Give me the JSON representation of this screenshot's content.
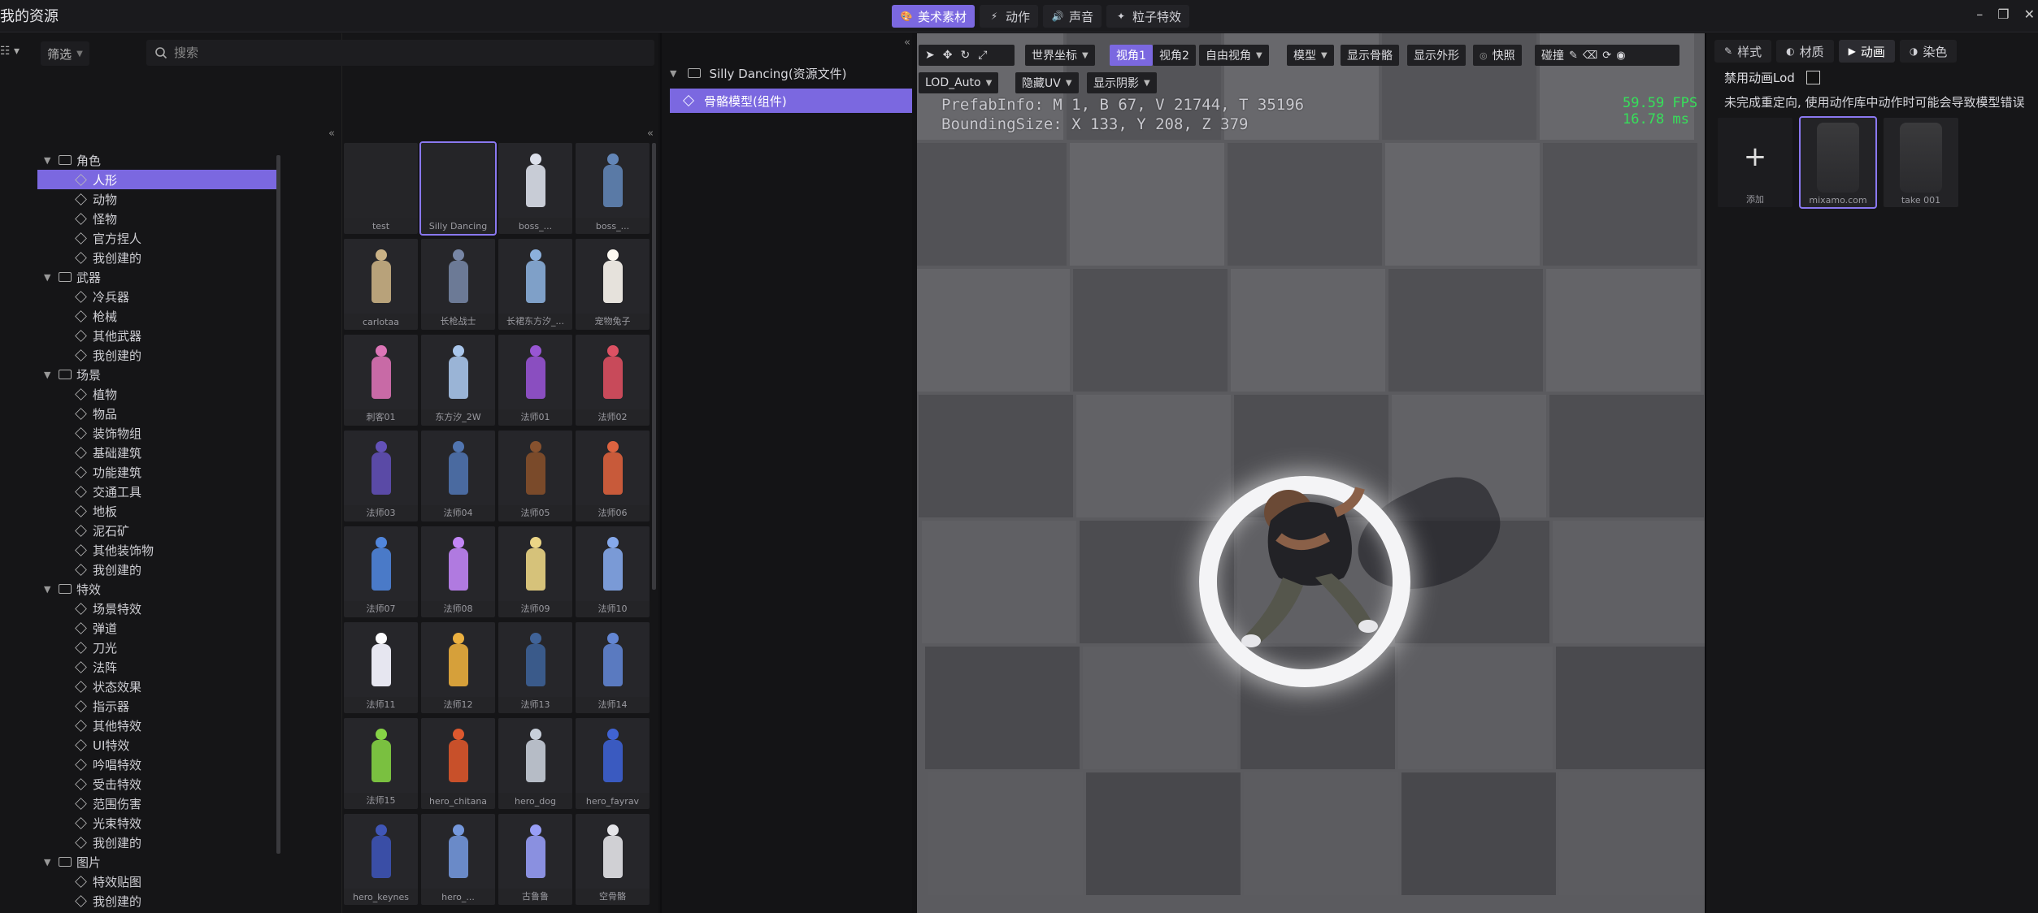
{
  "window": {
    "title": "我的资源",
    "controls": [
      "–",
      "❐",
      "✕"
    ]
  },
  "mode_tabs": [
    {
      "label": "美术素材",
      "icon": "palette-icon",
      "active": true
    },
    {
      "label": "动作",
      "icon": "motion-icon",
      "active": false
    },
    {
      "label": "声音",
      "icon": "sound-icon",
      "active": false
    },
    {
      "label": "粒子特效",
      "icon": "particle-icon",
      "active": false
    }
  ],
  "filter": {
    "label": "筛选",
    "caret": "▼"
  },
  "search": {
    "placeholder": "搜索"
  },
  "collapse": "«",
  "tree": [
    {
      "type": "folder",
      "label": "角色"
    },
    {
      "type": "leaf",
      "label": "人形",
      "selected": true
    },
    {
      "type": "leaf",
      "label": "动物"
    },
    {
      "type": "leaf",
      "label": "怪物"
    },
    {
      "type": "leaf",
      "label": "官方捏人"
    },
    {
      "type": "leaf",
      "label": "我创建的"
    },
    {
      "type": "folder",
      "label": "武器"
    },
    {
      "type": "leaf",
      "label": "冷兵器"
    },
    {
      "type": "leaf",
      "label": "枪械"
    },
    {
      "type": "leaf",
      "label": "其他武器"
    },
    {
      "type": "leaf",
      "label": "我创建的"
    },
    {
      "type": "folder",
      "label": "场景"
    },
    {
      "type": "leaf",
      "label": "植物"
    },
    {
      "type": "leaf",
      "label": "物品"
    },
    {
      "type": "leaf",
      "label": "装饰物组"
    },
    {
      "type": "leaf",
      "label": "基础建筑"
    },
    {
      "type": "leaf",
      "label": "功能建筑"
    },
    {
      "type": "leaf",
      "label": "交通工具"
    },
    {
      "type": "leaf",
      "label": "地板"
    },
    {
      "type": "leaf",
      "label": "泥石矿"
    },
    {
      "type": "leaf",
      "label": "其他装饰物"
    },
    {
      "type": "leaf",
      "label": "我创建的"
    },
    {
      "type": "folder",
      "label": "特效"
    },
    {
      "type": "leaf",
      "label": "场景特效"
    },
    {
      "type": "leaf",
      "label": "弹道"
    },
    {
      "type": "leaf",
      "label": "刀光"
    },
    {
      "type": "leaf",
      "label": "法阵"
    },
    {
      "type": "leaf",
      "label": "状态效果"
    },
    {
      "type": "leaf",
      "label": "指示器"
    },
    {
      "type": "leaf",
      "label": "其他特效"
    },
    {
      "type": "leaf",
      "label": "UI特效"
    },
    {
      "type": "leaf",
      "label": "吟唱特效"
    },
    {
      "type": "leaf",
      "label": "受击特效"
    },
    {
      "type": "leaf",
      "label": "范围伤害"
    },
    {
      "type": "leaf",
      "label": "光束特效"
    },
    {
      "type": "leaf",
      "label": "我创建的"
    },
    {
      "type": "folder",
      "label": "图片"
    },
    {
      "type": "leaf",
      "label": "特效贴图"
    },
    {
      "type": "leaf",
      "label": "我创建的"
    }
  ],
  "assets": [
    {
      "label": "test",
      "empty": true,
      "color": "#2a2a2d"
    },
    {
      "label": "Silly Dancing",
      "empty": true,
      "selected": true,
      "color": "#2a2a2d"
    },
    {
      "label": "boss_...",
      "color": "#c8ccd6"
    },
    {
      "label": "boss_...",
      "color": "#5a7aa6"
    },
    {
      "label": "carlotaa",
      "color": "#b8a27a"
    },
    {
      "label": "长枪战士",
      "color": "#6c7a96"
    },
    {
      "label": "长裙东方汐_...",
      "color": "#7fa0c8"
    },
    {
      "label": "宠物兔子",
      "color": "#e6e2dc"
    },
    {
      "label": "刺客01",
      "color": "#c86aa6"
    },
    {
      "label": "东方汐_2W",
      "color": "#9ab4d6"
    },
    {
      "label": "法师01",
      "color": "#8a4ec0"
    },
    {
      "label": "法师02",
      "color": "#c84a5a"
    },
    {
      "label": "法师03",
      "color": "#5a4aa6"
    },
    {
      "label": "法师04",
      "color": "#4a6aa0"
    },
    {
      "label": "法师05",
      "color": "#7a4a2a"
    },
    {
      "label": "法师06",
      "color": "#c85a3a"
    },
    {
      "label": "法师07",
      "color": "#4a7ac8"
    },
    {
      "label": "法师08",
      "color": "#b07ae0"
    },
    {
      "label": "法师09",
      "color": "#d6c27a"
    },
    {
      "label": "法师10",
      "color": "#7a9ad6"
    },
    {
      "label": "法师11",
      "color": "#e6e6f0"
    },
    {
      "label": "法师12",
      "color": "#d6a03a"
    },
    {
      "label": "法师13",
      "color": "#3a5a8a"
    },
    {
      "label": "法师14",
      "color": "#5a7ac0"
    },
    {
      "label": "法师15",
      "color": "#7ac040"
    },
    {
      "label": "hero_chitana",
      "color": "#c8502a"
    },
    {
      "label": "hero_dog",
      "color": "#b6bcc6"
    },
    {
      "label": "hero_fayrav",
      "color": "#3a5ac0"
    },
    {
      "label": "hero_keynes",
      "color": "#3a4ea6"
    },
    {
      "label": "hero_...",
      "color": "#6a8ac8"
    },
    {
      "label": "古鲁鲁",
      "color": "#8a90e0"
    },
    {
      "label": "空骨骼",
      "color": "#d0d0d4"
    }
  ],
  "scene": {
    "root": "Silly Dancing(资源文件)",
    "child": "骨骼模型(组件)"
  },
  "toolbar": {
    "row1": [
      {
        "label": "世界坐标",
        "dropdown": true
      },
      {
        "label": "视角1",
        "active": true
      },
      {
        "label": "视角2"
      },
      {
        "label": "自由视角",
        "dropdown": true
      },
      {
        "label": "模型",
        "dropdown": true
      },
      {
        "label": "显示骨骼"
      },
      {
        "label": "显示外形"
      },
      {
        "label": "快照"
      },
      {
        "label": "碰撞"
      }
    ],
    "row2": [
      {
        "label": "LOD_Auto",
        "dropdown": true
      },
      {
        "label": "隐藏UV",
        "dropdown": true
      },
      {
        "label": "显示阴影",
        "dropdown": true
      }
    ]
  },
  "viewport_info": {
    "line1": "PrefabInfo: M 1, B 67, V 21744, T 35196",
    "line2": "BoundingSize: X 133, Y 208, Z 379",
    "fps": "59.59 FPS",
    "ms": "16.78 ms"
  },
  "right_panel": {
    "tabs": [
      {
        "label": "样式",
        "icon": "edit-icon"
      },
      {
        "label": "材质",
        "icon": "material-icon"
      },
      {
        "label": "动画",
        "icon": "play-icon",
        "active": true
      },
      {
        "label": "染色",
        "icon": "dye-icon"
      }
    ],
    "lod_label": "禁用动画Lod",
    "warning": "未完成重定向, 使用动作库中动作时可能会导致模型错误",
    "animations": [
      {
        "label": "添加",
        "add": true
      },
      {
        "label": "mixamo.com",
        "selected": true
      },
      {
        "label": "take 001"
      }
    ]
  },
  "colors": {
    "accent": "#7b68e0",
    "fps_green": "#36e05a"
  }
}
